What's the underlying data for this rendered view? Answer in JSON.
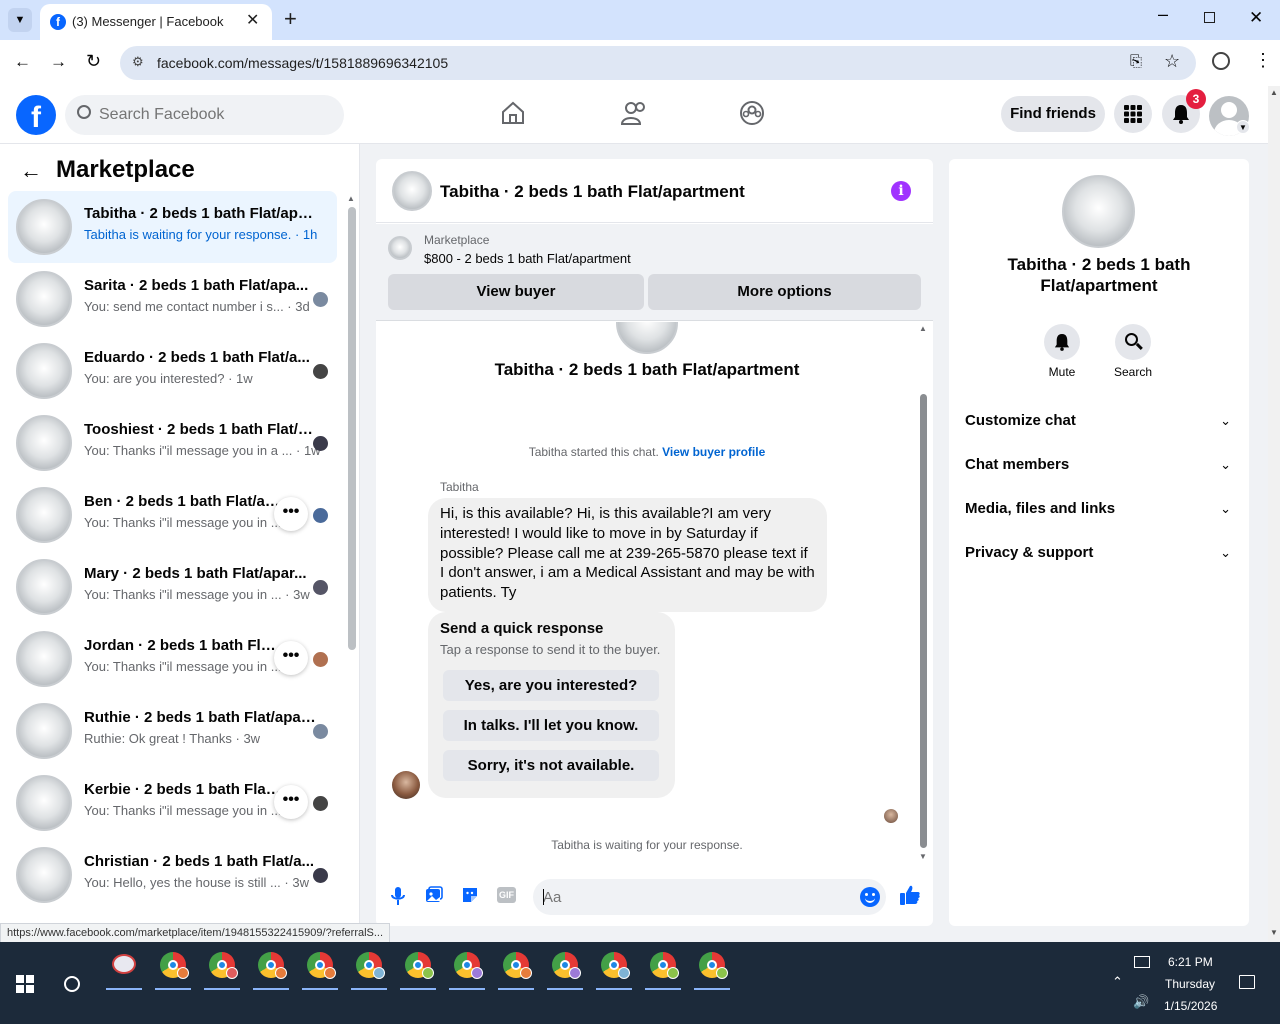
{
  "browser": {
    "tab_title": "(3) Messenger | Facebook",
    "url": "facebook.com/messages/t/1581889696342105",
    "status_url": "https://www.facebook.com/marketplace/item/1948155322415909/?referralS..."
  },
  "header": {
    "search_placeholder": "Search Facebook",
    "find_friends": "Find friends",
    "notif_count": "3"
  },
  "sidebar": {
    "title": "Marketplace",
    "conversations": [
      {
        "name": "Tabitha · 2 beds 1 bath Flat/apar...",
        "preview": "Tabitha is waiting for your response. · 1h",
        "active": true
      },
      {
        "name": "Sarita · 2 beds 1 bath Flat/apa...",
        "preview": "You: send me contact number i s... · 3d"
      },
      {
        "name": "Eduardo · 2 beds 1 bath Flat/a...",
        "preview": "You: are you interested? · 1w"
      },
      {
        "name": "Tooshiest · 2 beds 1 bath Flat/ap...",
        "preview": "You: Thanks i\"il message you in a ... · 1w"
      },
      {
        "name": "Ben · 2 beds 1 bath Flat/apart",
        "preview": "You: Thanks i\"il message you in ..."
      },
      {
        "name": "Mary · 2 beds 1 bath Flat/apar...",
        "preview": "You: Thanks i\"il message you in ... · 3w"
      },
      {
        "name": "Jordan · 2 beds 1 bath Flat/ar",
        "preview": "You: Thanks i\"il message you in ..."
      },
      {
        "name": "Ruthie · 2 beds 1 bath Flat/apart...",
        "preview": "Ruthie: Ok great ! Thanks · 3w"
      },
      {
        "name": "Kerbie · 2 beds 1 bath Flat/ap",
        "preview": "You: Thanks i\"il message you in ..."
      },
      {
        "name": "Christian · 2 beds 1 bath Flat/a...",
        "preview": "You: Hello, yes the house is still ... · 3w"
      }
    ]
  },
  "chat": {
    "title": "Tabitha · 2 beds 1 bath Flat/apartment",
    "listing_label": "Marketplace",
    "listing_text": "$800 - 2 beds 1 bath Flat/apartment",
    "view_buyer": "View buyer",
    "more_options": "More options",
    "intro_title": "Tabitha · 2 beds 1 bath Flat/apartment",
    "started_text": "Tabitha started this chat.",
    "view_profile": "View buyer profile",
    "sender": "Tabitha",
    "message": "Hi, is this available? Hi, is this available?I am very interested! I would like to move in by Saturday if possible? Please call me at 239-265-5870 please text if I don't answer, i am a Medical Assistant and may be with patients. Ty",
    "quick_title": "Send a quick response",
    "quick_sub": "Tap a response to send it to the buyer.",
    "quick_replies": [
      "Yes, are you interested?",
      "In talks. I'll let you know.",
      "Sorry, it's not available."
    ],
    "waiting": "Tabitha is waiting for your response.",
    "input_placeholder": "Aa"
  },
  "details": {
    "title": "Tabitha · 2 beds 1 bath Flat/apartment",
    "mute": "Mute",
    "search": "Search",
    "sections": [
      "Customize chat",
      "Chat members",
      "Media, files and links",
      "Privacy & support"
    ]
  },
  "taskbar": {
    "time": "6:21 PM",
    "day": "Thursday",
    "date": "1/15/2026"
  },
  "colors": {
    "facebook_blue": "#0866ff",
    "messenger_purple": "#a033ff",
    "badge_red": "#e41e3f"
  }
}
